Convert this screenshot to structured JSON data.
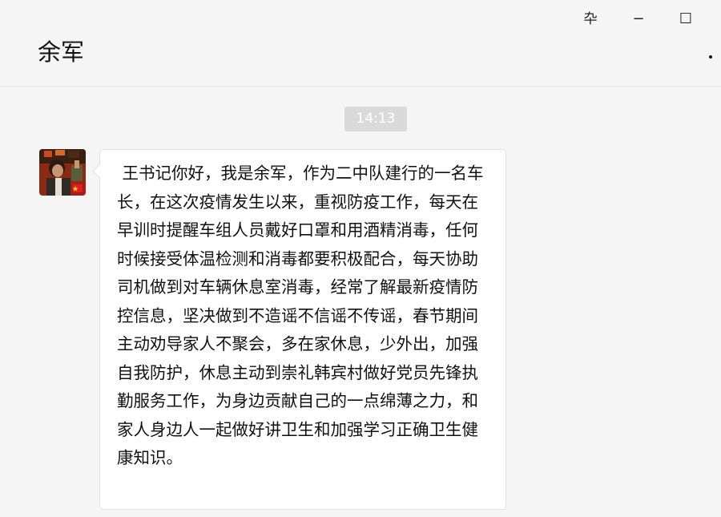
{
  "header": {
    "contact_name": "余军"
  },
  "window_controls": {
    "pin_icon": "pin-icon",
    "pin_glyph": "卆",
    "minimize_glyph": "−",
    "maximize_glyph": "☐"
  },
  "conversation": {
    "timestamp": "14:13",
    "messages": [
      {
        "sender_avatar": "avatar-image",
        "text": " 王书记你好，我是余军，作为二中队建行的一名车长，在这次疫情发生以来，重视防疫工作，每天在早训时提醒车组人员戴好口罩和用酒精消毒，任何时候接受体温检测和消毒都要积极配合，每天协助司机做到对车辆休息室消毒，经常了解最新疫情防控信息，坚决做到不造谣不信谣不传谣，春节期间主动劝导家人不聚会，多在家休息，少外出，加强自我防护，休息主动到崇礼韩宾村做好党员先锋执勤服务工作，为身边贡献自己的一点绵薄之力，和家人身边人一起做好讲卫生和加强学习正确卫生健康知识。"
      }
    ]
  },
  "colors": {
    "background": "#f5f5f5",
    "bubble": "#ffffff",
    "timestamp_bg": "#dadada"
  }
}
